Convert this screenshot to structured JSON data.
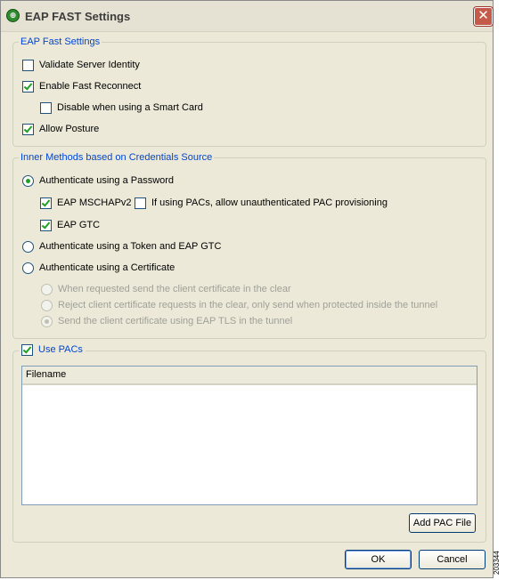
{
  "window": {
    "title": "EAP FAST Settings",
    "close_symbol": "✕"
  },
  "eap_fast_settings": {
    "legend": "EAP Fast Settings",
    "validate_server_identity": {
      "label": "Validate Server Identity",
      "checked": false
    },
    "enable_fast_reconnect": {
      "label": "Enable Fast Reconnect",
      "checked": true
    },
    "disable_smart_card": {
      "label": "Disable when using a Smart Card",
      "checked": false
    },
    "allow_posture": {
      "label": "Allow Posture",
      "checked": true
    }
  },
  "inner_methods": {
    "legend": "Inner Methods based on Credentials Source",
    "auth_password": {
      "label": "Authenticate using a Password",
      "selected": true
    },
    "eap_mschapv2": {
      "label": "EAP MSCHAPv2",
      "checked": true
    },
    "unauth_pac": {
      "label": "If using PACs, allow unauthenticated PAC provisioning",
      "checked": false
    },
    "eap_gtc": {
      "label": "EAP GTC",
      "checked": true
    },
    "auth_token": {
      "label": "Authenticate using a Token and EAP GTC",
      "selected": false
    },
    "auth_certificate": {
      "label": "Authenticate using a Certificate",
      "selected": false
    },
    "cert_clear": {
      "label": "When requested send the client certificate in the clear",
      "selected": false,
      "enabled": false
    },
    "cert_reject": {
      "label": "Reject client certificate requests in the clear, only send when protected inside the tunnel",
      "selected": false,
      "enabled": false
    },
    "cert_tunnel": {
      "label": "Send the client certificate using EAP TLS in the tunnel",
      "selected": true,
      "enabled": false
    }
  },
  "use_pacs": {
    "label": "Use PACs",
    "checked": true,
    "list_header": "Filename",
    "files": [],
    "add_button": "Add PAC File"
  },
  "footer": {
    "ok_label": "OK",
    "cancel_label": "Cancel",
    "figure_number": "203344"
  },
  "colors": {
    "legend_text": "#0046d5",
    "check_mark": "#21a121",
    "close_button": "#c45a4a"
  }
}
